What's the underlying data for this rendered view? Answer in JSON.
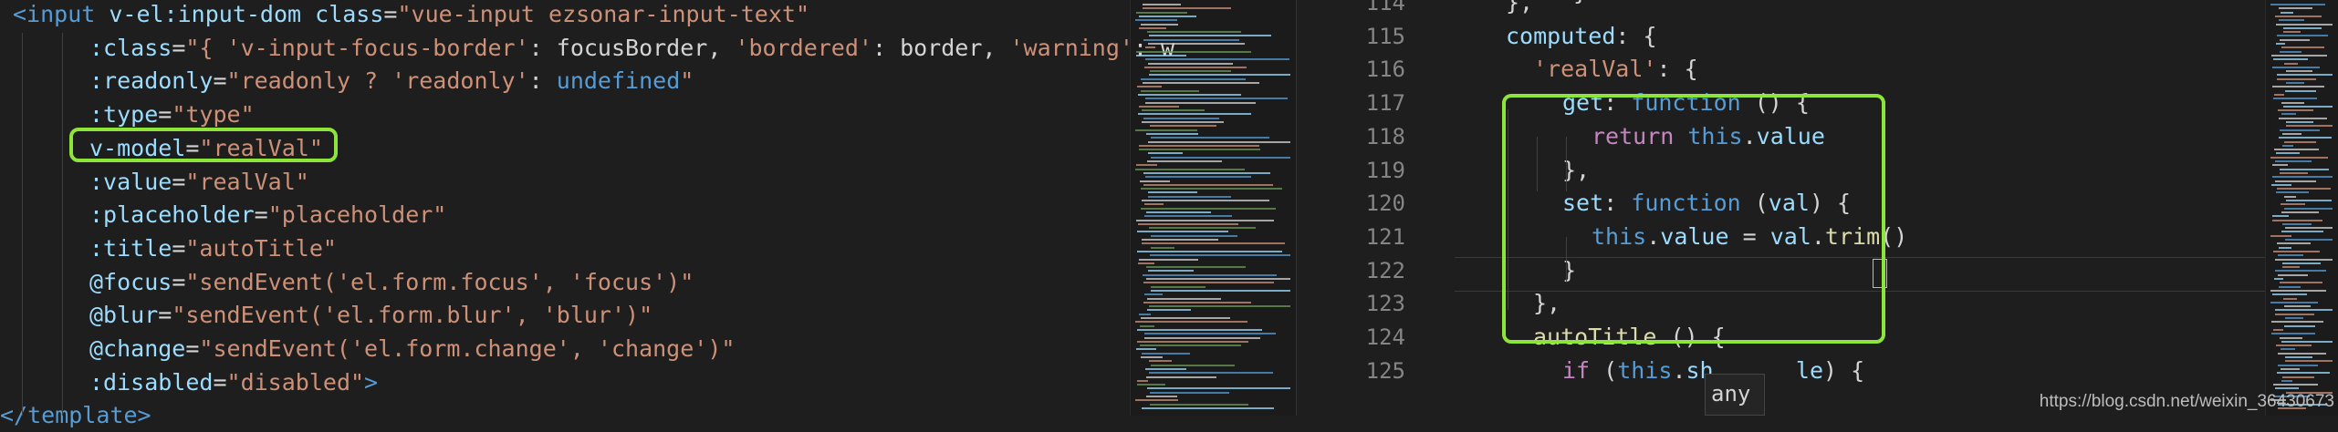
{
  "left_editor": {
    "lines": [
      {
        "id": "l1",
        "parts": [
          [
            "tag",
            "<input "
          ],
          [
            "attr",
            "v-el:input-dom "
          ],
          [
            "attr",
            "class"
          ],
          [
            "eq",
            "="
          ],
          [
            "str",
            "\"vue-input ezsonar-input-text\""
          ]
        ]
      },
      {
        "id": "l2",
        "parts": [
          [
            "attr",
            ":class"
          ],
          [
            "eq",
            "="
          ],
          [
            "str",
            "\"{ 'v-input-focus-border'"
          ],
          [
            "punc",
            ": focusBorder, "
          ],
          [
            "str",
            "'bordered'"
          ],
          [
            "punc",
            ": border, "
          ],
          [
            "str",
            "'warning'"
          ],
          [
            "punc",
            ": w"
          ]
        ]
      },
      {
        "id": "l3",
        "parts": [
          [
            "attr",
            ":readonly"
          ],
          [
            "eq",
            "="
          ],
          [
            "str",
            "\"readonly ? 'readonly'"
          ],
          [
            "punc",
            ": "
          ],
          [
            "kw",
            "undefined"
          ],
          [
            "str",
            "\""
          ]
        ]
      },
      {
        "id": "l4",
        "parts": [
          [
            "attr",
            ":type"
          ],
          [
            "eq",
            "="
          ],
          [
            "str",
            "\"type\""
          ]
        ]
      },
      {
        "id": "l5",
        "parts": [
          [
            "attr",
            "v-model"
          ],
          [
            "eq",
            "="
          ],
          [
            "str",
            "\"realVal\""
          ]
        ]
      },
      {
        "id": "l6",
        "parts": [
          [
            "attr",
            ":value"
          ],
          [
            "eq",
            "="
          ],
          [
            "str",
            "\"realVal\""
          ]
        ]
      },
      {
        "id": "l7",
        "parts": [
          [
            "attr",
            ":placeholder"
          ],
          [
            "eq",
            "="
          ],
          [
            "str",
            "\"placeholder\""
          ]
        ]
      },
      {
        "id": "l8",
        "parts": [
          [
            "attr",
            ":title"
          ],
          [
            "eq",
            "="
          ],
          [
            "str",
            "\"autoTitle\""
          ]
        ]
      },
      {
        "id": "l9",
        "parts": [
          [
            "attr",
            "@focus"
          ],
          [
            "eq",
            "="
          ],
          [
            "str",
            "\"sendEvent('el.form.focus', 'focus')\""
          ]
        ]
      },
      {
        "id": "l10",
        "parts": [
          [
            "attr",
            "@blur"
          ],
          [
            "eq",
            "="
          ],
          [
            "str",
            "\"sendEvent('el.form.blur', 'blur')\""
          ]
        ]
      },
      {
        "id": "l11",
        "parts": [
          [
            "attr",
            "@change"
          ],
          [
            "eq",
            "="
          ],
          [
            "str",
            "\"sendEvent('el.form.change', 'change')\""
          ]
        ]
      },
      {
        "id": "l12",
        "parts": [
          [
            "attr",
            ":disabled"
          ],
          [
            "eq",
            "="
          ],
          [
            "str",
            "\"disabled\""
          ],
          [
            "tag",
            ">"
          ]
        ]
      },
      {
        "id": "l13",
        "parts": [
          [
            "tag",
            "</template>"
          ]
        ]
      }
    ]
  },
  "right_editor": {
    "line_numbers": [
      "114",
      "115",
      "116",
      "117",
      "118",
      "119",
      "120",
      "121",
      "122",
      "123",
      "124",
      "125"
    ],
    "lines": [
      {
        "id": "r1",
        "parts": [
          [
            "punc",
            "},"
          ]
        ]
      },
      {
        "id": "r2",
        "parts": [
          [
            "prop",
            "computed"
          ],
          [
            "punc",
            ": {"
          ]
        ]
      },
      {
        "id": "r3",
        "parts": [
          [
            "str",
            "'realVal'"
          ],
          [
            "punc",
            ": {"
          ]
        ]
      },
      {
        "id": "r4",
        "parts": [
          [
            "prop",
            "get"
          ],
          [
            "punc",
            ": "
          ],
          [
            "kw",
            "function"
          ],
          [
            "punc",
            " () {"
          ]
        ]
      },
      {
        "id": "r5",
        "parts": [
          [
            "ctrl",
            "return "
          ],
          [
            "kw",
            "this"
          ],
          [
            "punc",
            "."
          ],
          [
            "prop",
            "value"
          ]
        ]
      },
      {
        "id": "r6",
        "parts": [
          [
            "punc",
            "},"
          ]
        ]
      },
      {
        "id": "r7",
        "parts": [
          [
            "prop",
            "set"
          ],
          [
            "punc",
            ": "
          ],
          [
            "kw",
            "function"
          ],
          [
            "punc",
            " ("
          ],
          [
            "prop",
            "val"
          ],
          [
            "punc",
            ") {"
          ]
        ]
      },
      {
        "id": "r8",
        "parts": [
          [
            "kw",
            "this"
          ],
          [
            "punc",
            "."
          ],
          [
            "prop",
            "value"
          ],
          [
            "punc",
            " = "
          ],
          [
            "prop",
            "val"
          ],
          [
            "punc",
            "."
          ],
          [
            "fn",
            "trim"
          ],
          [
            "punc",
            "()"
          ]
        ]
      },
      {
        "id": "r9",
        "parts": [
          [
            "punc",
            "}"
          ]
        ]
      },
      {
        "id": "r10",
        "parts": [
          [
            "punc",
            "},"
          ]
        ]
      },
      {
        "id": "r11",
        "parts": [
          [
            "fn",
            "autoTitle"
          ],
          [
            "punc",
            " () {"
          ]
        ]
      },
      {
        "id": "r12",
        "parts": [
          [
            "ctrl",
            "if "
          ],
          [
            "punc",
            "("
          ],
          [
            "kw",
            "this"
          ],
          [
            "punc",
            "."
          ],
          [
            "prop",
            "sh"
          ],
          [
            "punc",
            "      "
          ],
          [
            "prop",
            "le"
          ],
          [
            "punc",
            ") {"
          ]
        ]
      }
    ],
    "top_partial": "}"
  },
  "tooltip": {
    "text": "any"
  },
  "watermark": {
    "text": "https://blog.csdn.net/weixin_36430673"
  },
  "colors": {
    "highlight": "#8ee53a",
    "background": "#1e1e1e",
    "string": "#ce9178",
    "attribute": "#9cdcfe",
    "keyword": "#569cd6"
  }
}
